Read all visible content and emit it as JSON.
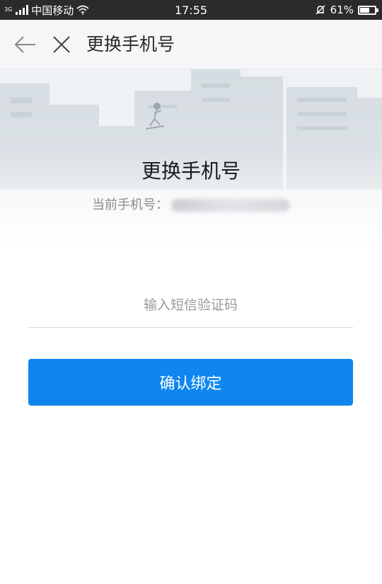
{
  "status_bar": {
    "network_type": "3G",
    "carrier": "中国移动",
    "time": "17:55",
    "battery": "61%",
    "battery_level": 0.61
  },
  "nav": {
    "title": "更换手机号",
    "back_icon": "arrow-left-icon",
    "close_icon": "close-icon"
  },
  "hero": {
    "title": "更换手机号",
    "phone_label": "当前手机号："
  },
  "form": {
    "code_placeholder": "输入短信验证码",
    "code_value": ""
  },
  "actions": {
    "confirm_label": "确认绑定"
  },
  "colors": {
    "primary": "#0e86ee",
    "status_bar_bg": "#2b2b2b",
    "nav_bg": "#f6f6f8"
  }
}
